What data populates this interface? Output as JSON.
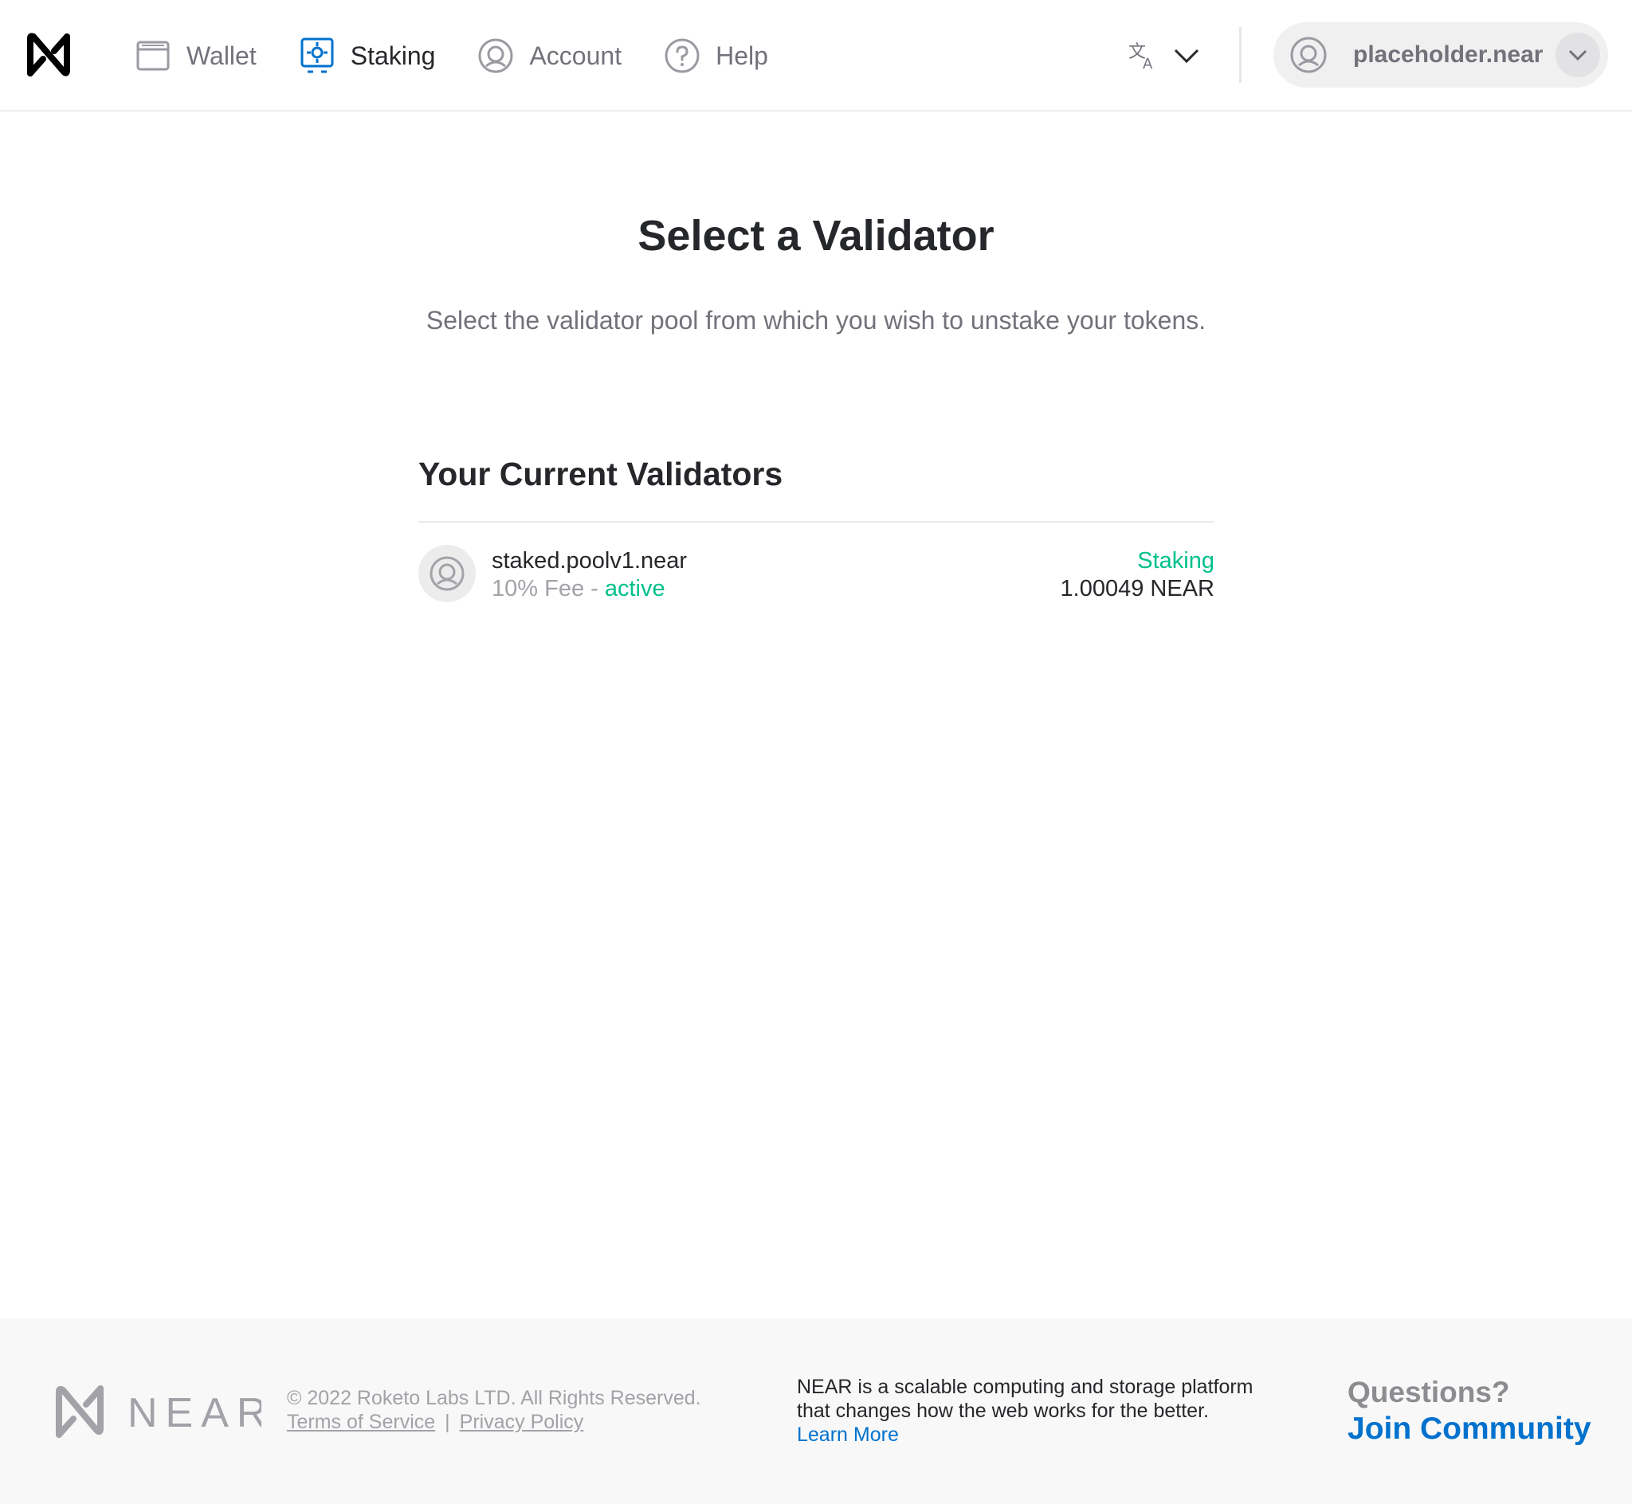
{
  "header": {
    "nav": [
      {
        "label": "Wallet",
        "icon": "wallet-icon"
      },
      {
        "label": "Staking",
        "icon": "staking-icon",
        "active": true
      },
      {
        "label": "Account",
        "icon": "account-icon"
      },
      {
        "label": "Help",
        "icon": "help-icon"
      }
    ],
    "account_name": "placeholder.near"
  },
  "main": {
    "title": "Select a Validator",
    "subtitle": "Select the validator pool from which you wish to unstake your tokens.",
    "section_title": "Your Current Validators",
    "validators": [
      {
        "name": "staked.poolv1.near",
        "fee": "10% Fee",
        "separator": "-",
        "state": "active",
        "status": "Staking",
        "amount": "1.00049 NEAR"
      }
    ]
  },
  "footer": {
    "brand": "NEAR",
    "copyright": "© 2022 Roketo Labs LTD. All Rights Reserved.",
    "terms": "Terms of Service",
    "link_separator": "|",
    "privacy": "Privacy Policy",
    "about": "NEAR is a scalable computing and storage platform that changes how the web works for the better.",
    "learn_more": "Learn More",
    "questions": "Questions?",
    "join": "Join Community"
  },
  "colors": {
    "accent_blue": "#0072ce",
    "active_green": "#00c08b",
    "text_dark": "#25272a",
    "text_gray": "#72727a"
  }
}
